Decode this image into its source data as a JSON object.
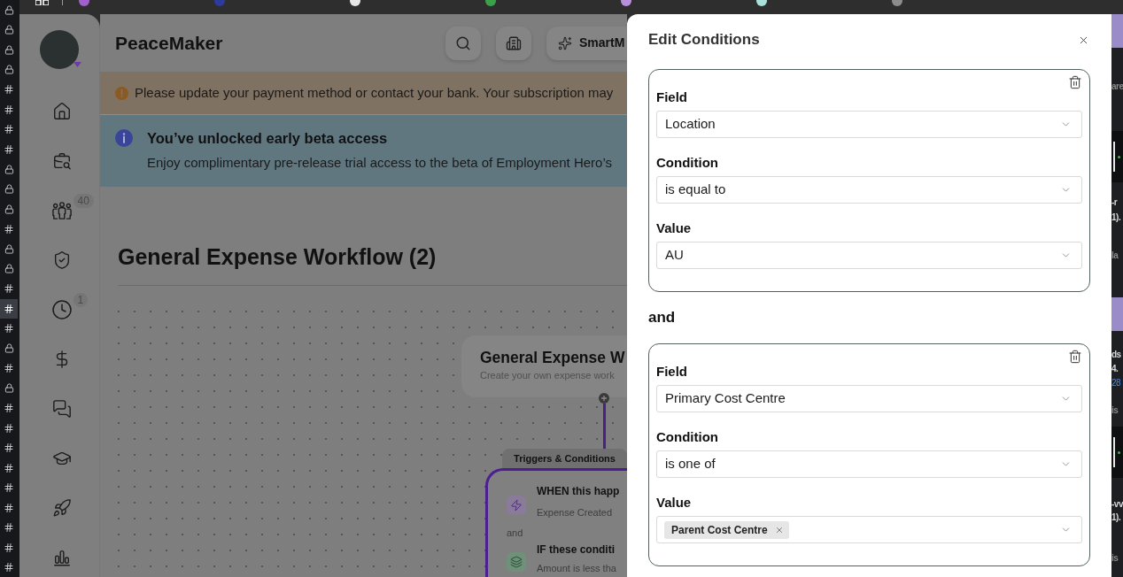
{
  "left_rail": {
    "items": [
      {
        "kind": "lock",
        "selected": false
      },
      {
        "kind": "lock",
        "selected": false
      },
      {
        "kind": "lock",
        "selected": false
      },
      {
        "kind": "lock",
        "selected": false
      },
      {
        "kind": "channel",
        "selected": false
      },
      {
        "kind": "channel",
        "selected": false
      },
      {
        "kind": "channel",
        "selected": false
      },
      {
        "kind": "channel",
        "selected": false
      },
      {
        "kind": "lock",
        "selected": false
      },
      {
        "kind": "lock",
        "selected": false
      },
      {
        "kind": "lock",
        "selected": false
      },
      {
        "kind": "channel",
        "selected": false
      },
      {
        "kind": "lock",
        "selected": false
      },
      {
        "kind": "lock",
        "selected": false
      },
      {
        "kind": "channel",
        "selected": false
      },
      {
        "kind": "channel",
        "selected": true
      },
      {
        "kind": "channel",
        "selected": false
      },
      {
        "kind": "lock",
        "selected": false
      },
      {
        "kind": "channel",
        "selected": false
      },
      {
        "kind": "lock",
        "selected": false
      },
      {
        "kind": "channel",
        "selected": false
      },
      {
        "kind": "channel",
        "selected": false
      },
      {
        "kind": "channel",
        "selected": false
      },
      {
        "kind": "channel",
        "selected": false
      },
      {
        "kind": "channel",
        "selected": false
      },
      {
        "kind": "channel",
        "selected": false
      },
      {
        "kind": "channel",
        "selected": false
      },
      {
        "kind": "channel",
        "selected": false
      },
      {
        "kind": "channel",
        "selected": false
      }
    ]
  },
  "top_bar": {
    "bookmarks": [
      {
        "color": "#a25fd0"
      },
      {
        "color": "#2b3a9c"
      },
      {
        "color": "#e6e6e6"
      },
      {
        "color": "#3aa04a"
      },
      {
        "color": "#b98fdc"
      },
      {
        "color": "#a9e0da"
      },
      {
        "color": "#8c8c8c"
      }
    ]
  },
  "sidebar": {
    "items": [
      {
        "kind": "home"
      },
      {
        "kind": "briefcase"
      },
      {
        "kind": "people",
        "badge": "40"
      },
      {
        "kind": "shield"
      },
      {
        "kind": "clock",
        "badge": "1"
      },
      {
        "kind": "dollar"
      },
      {
        "kind": "chat"
      },
      {
        "kind": "education"
      },
      {
        "kind": "rocket"
      },
      {
        "kind": "chart"
      }
    ]
  },
  "header": {
    "title": "PeaceMaker",
    "buttons": [
      {
        "kind": "search"
      },
      {
        "kind": "building"
      },
      {
        "kind": "assistant",
        "label": "SmartM"
      }
    ]
  },
  "payment_banner": {
    "text": "Please update your payment method or contact your bank. Your subscription may"
  },
  "beta_banner": {
    "title": "You’ve unlocked early beta access",
    "text": "Enjoy complimentary pre-release trial access to the beta of Employment Hero’s"
  },
  "page_title": "General Expense Workflow (2)",
  "workflow": {
    "start_node": {
      "title": "General Expense W",
      "subtitle": "Create your own expense work"
    },
    "section_label": "Triggers & Conditions",
    "steps": [
      {
        "kind": "trigger",
        "title": "WHEN this happ",
        "detail": "Expense Created"
      },
      {
        "kind": "condition",
        "title": "IF these conditi",
        "detail": "Amount is less tha"
      }
    ],
    "joiner": "and"
  },
  "modal": {
    "title": "Edit Conditions",
    "groups": [
      {
        "rows": [
          {
            "label": "Field",
            "value": "Location"
          },
          {
            "label": "Condition",
            "value": "is equal to"
          },
          {
            "label": "Value",
            "value": "AU"
          }
        ]
      },
      {
        "rows": [
          {
            "label": "Field",
            "value": "Primary Cost Centre"
          },
          {
            "label": "Condition",
            "value": "is one of"
          },
          {
            "label": "Value",
            "chips": [
              "Parent Cost Centre"
            ]
          }
        ]
      }
    ],
    "joiner": "and"
  },
  "side_window": {
    "rows": [
      {
        "kind": "band"
      },
      {
        "kind": "muted",
        "text": "are"
      },
      {
        "kind": "media"
      },
      {
        "kind": "text",
        "text": "-r"
      },
      {
        "kind": "text",
        "text": "1)."
      },
      {
        "kind": "muted",
        "text": "la"
      },
      {
        "kind": "band"
      },
      {
        "kind": "text",
        "text": "ds"
      },
      {
        "kind": "text",
        "text": "4."
      },
      {
        "kind": "link",
        "text": "28"
      },
      {
        "kind": "muted",
        "text": "is"
      },
      {
        "kind": "media"
      },
      {
        "kind": "text",
        "text": "-vv"
      },
      {
        "kind": "text",
        "text": "1)."
      },
      {
        "kind": "muted",
        "text": "is"
      }
    ]
  }
}
